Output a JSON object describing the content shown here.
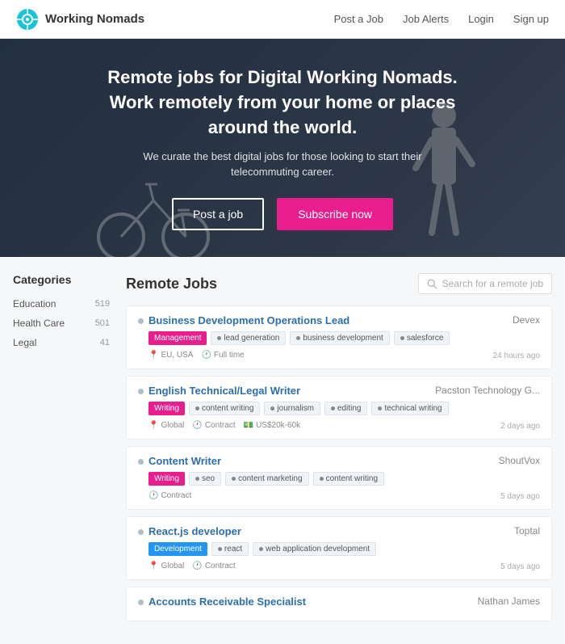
{
  "navbar": {
    "brand_name": "Working Nomads",
    "links": [
      {
        "id": "post-job",
        "label": "Post a Job"
      },
      {
        "id": "job-alerts",
        "label": "Job Alerts"
      },
      {
        "id": "login",
        "label": "Login"
      },
      {
        "id": "signup",
        "label": "Sign up"
      }
    ]
  },
  "hero": {
    "title": "Remote jobs for Digital Working Nomads.\nWork remotely from your home or places\naround the world.",
    "subtitle": "We curate the best digital jobs for those looking to start their\ntelecommuting career.",
    "btn_post": "Post a job",
    "btn_subscribe": "Subscribe now"
  },
  "sidebar": {
    "title": "Categories",
    "items": [
      {
        "label": "Education",
        "count": "519"
      },
      {
        "label": "Health Care",
        "count": "501"
      },
      {
        "label": "Legal",
        "count": "41"
      }
    ]
  },
  "content": {
    "title": "Remote Jobs",
    "search_placeholder": "Search for a remote job",
    "jobs": [
      {
        "title": "Business Development Operations Lead",
        "company": "Devex",
        "category": "Management",
        "category_type": "management",
        "tags": [
          "lead generation",
          "business development",
          "salesforce"
        ],
        "meta": [
          "EU, USA",
          "Full time"
        ],
        "time": "24 hours ago"
      },
      {
        "title": "English Technical/Legal Writer",
        "company": "Pacston Technology G...",
        "category": "Writing",
        "category_type": "writing",
        "tags": [
          "content writing",
          "journalism",
          "editing",
          "technical writing"
        ],
        "meta": [
          "Global",
          "Contract",
          "US$20k-60k"
        ],
        "time": "2 days ago"
      },
      {
        "title": "Content Writer",
        "company": "ShoutVox",
        "category": "Writing",
        "category_type": "writing",
        "tags": [
          "seo",
          "content marketing",
          "content writing"
        ],
        "meta": [
          "Contract"
        ],
        "time": "5 days ago"
      },
      {
        "title": "React.js developer",
        "company": "Toptal",
        "category": "Development",
        "category_type": "development",
        "tags": [
          "react",
          "web application development"
        ],
        "meta": [
          "Global",
          "Contract"
        ],
        "time": "5 days ago"
      },
      {
        "title": "Accounts Receivable Specialist",
        "company": "Nathan James",
        "category": "",
        "category_type": "",
        "tags": [],
        "meta": [],
        "time": ""
      }
    ]
  }
}
